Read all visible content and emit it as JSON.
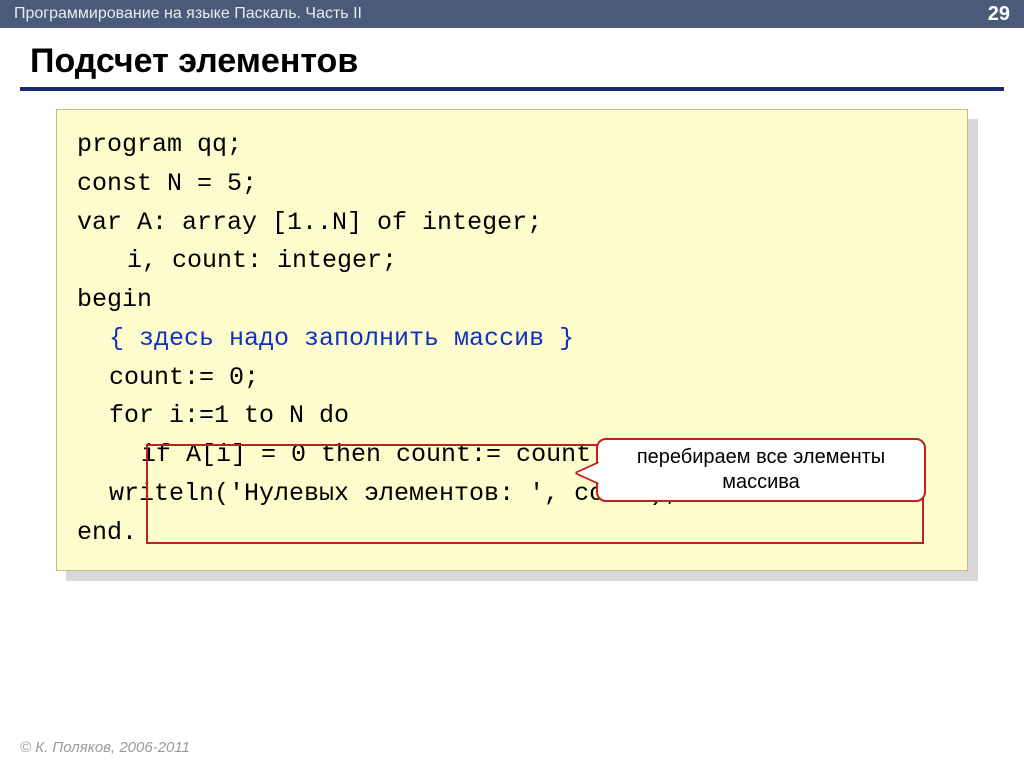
{
  "topbar": {
    "title": "Программирование на языке Паскаль. Часть II",
    "page": "29"
  },
  "heading": "Подсчет элементов",
  "code": {
    "l1": "program qq;",
    "l2": "const N = 5;",
    "l3": "var A: array [1..N] of integer;",
    "l4": "i, count: integer;",
    "l5": "begin",
    "l6": "{ здесь надо заполнить массив }",
    "l7": "count:= 0;",
    "l8": "for i:=1 to N do",
    "l9": "if A[i] = 0 then count:= count + 1;",
    "l10": "writeln('Нулевых элементов: ', count);",
    "l11": "end."
  },
  "callout": "перебираем все элементы массива",
  "footer": "© К. Поляков, 2006-2011"
}
